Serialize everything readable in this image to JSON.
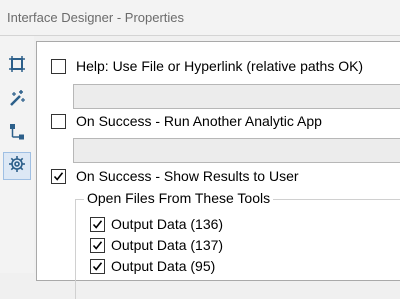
{
  "window": {
    "title": "Interface Designer - Properties"
  },
  "sidebar": {
    "items": [
      {
        "icon": "layout-icon",
        "active": false
      },
      {
        "icon": "magic-wand-icon",
        "active": false
      },
      {
        "icon": "tree-icon",
        "active": false
      },
      {
        "icon": "gear-icon",
        "active": true
      }
    ]
  },
  "properties": {
    "help": {
      "label": "Help: Use File or Hyperlink (relative paths OK)",
      "checked": false,
      "value": ""
    },
    "run_app": {
      "label": "On Success - Run Another Analytic App",
      "checked": false,
      "value": ""
    },
    "show_results": {
      "label": "On Success - Show Results to User",
      "checked": true
    },
    "open_files": {
      "title": "Open Files From These Tools",
      "items": [
        {
          "label": "Output Data (136)",
          "checked": true
        },
        {
          "label": "Output Data (137)",
          "checked": true
        },
        {
          "label": "Output Data (95)",
          "checked": true
        }
      ]
    }
  },
  "colors": {
    "active_tab_bg": "#dde8f5",
    "icon_blue": "#2c5f8a"
  }
}
